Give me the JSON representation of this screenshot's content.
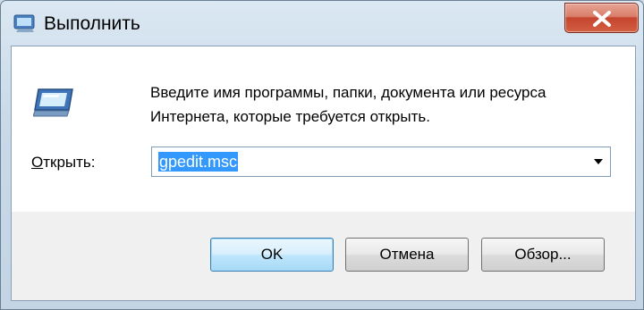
{
  "window": {
    "title": "Выполнить",
    "icon": "run-dialog-icon"
  },
  "titlebar": {
    "close_icon": "close-icon"
  },
  "dialog": {
    "icon": "run-program-icon",
    "description": "Введите имя программы, папки, документа или ресурса Интернета, которые требуется открыть.",
    "open_label_accel": "О",
    "open_label_rest": "ткрыть:",
    "open_value": "gpedit.msc",
    "dropdown_icon": "chevron-down-icon"
  },
  "buttons": {
    "ok": "OK",
    "cancel": "Отмена",
    "browse": "Обзор..."
  },
  "colors": {
    "selection": "#3399ff",
    "close_button": "#c6452e",
    "default_button": "#3c7fb1"
  }
}
